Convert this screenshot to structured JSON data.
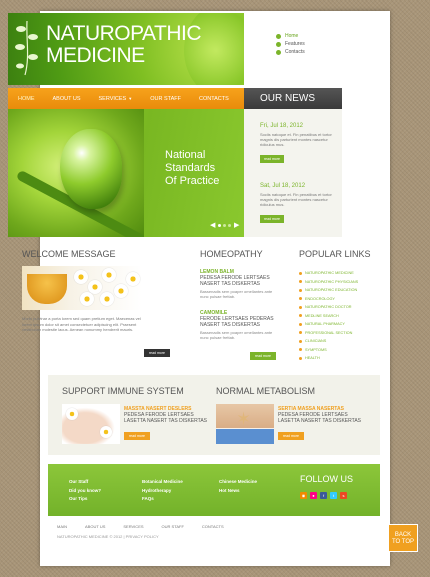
{
  "header": {
    "logo_line1": "NATUROPATHIC",
    "logo_line2": "MEDICINE",
    "top_links": [
      "Home",
      "Features",
      "Contacts"
    ]
  },
  "nav": {
    "items": [
      "HOME",
      "ABOUT US",
      "SERVICES",
      "OUR STAFF",
      "CONTACTS"
    ],
    "active": "HOME"
  },
  "news": {
    "title": "OUR NEWS",
    "items": [
      {
        "date": "Fri, Jul 18, 2012",
        "text": "Sociis natoque et. Fin penatibus et tortor magnis dis parturient montes nascetur ridiculus mus.",
        "button": "read more"
      },
      {
        "date": "Sat, Jul 18, 2012",
        "text": "Sociis natoque et. Fin penatibus et tortor magnis dis parturient montes nascetur ridiculus mus.",
        "button": "read more"
      }
    ]
  },
  "slider": {
    "line1": "National",
    "line2": "Standards",
    "line3": "Of Practice",
    "prev": "◀",
    "next": "▶"
  },
  "welcome": {
    "title": "WELCOME MESSAGE",
    "text": "Morbi pulvinar a porta lorem sed quam pretium eget. Maecenas vel lorem ipsum dolor sit amet consectetuer adipiscing elit. Praesent vestibulum molestie lacus. Aenean nonummy hendrerit mauris.",
    "button": "read more"
  },
  "homeopathy": {
    "title": "HOMEOPATHY",
    "items": [
      {
        "head": "LEMON BALM",
        "sub": "PEDESA FERODE LERTSAES NASERT TAS DISKERTAS",
        "text": "Bassenadis sem poaper omellantes ante nunc pulsae frettab."
      },
      {
        "head": "CAMOMILE",
        "sub": "FERODE LERTSAES PEDERAS NASERT TAS DISKERTAS",
        "text": "Bassenadis sem poaper omellantes ante nunc pulsae frettab."
      }
    ],
    "button": "read more"
  },
  "popular": {
    "title": "POPULAR LINKS",
    "links": [
      "Naturopathic medicine",
      "Naturopathic physicians",
      "Naturopathic education",
      "Endocrology",
      "Naturopathic doctor",
      "Medline search",
      "Natural pharmacy",
      "Professional section",
      "Clinicians",
      "Symptoms",
      "Health"
    ]
  },
  "immune": {
    "title": "SUPPORT IMMUNE SYSTEM",
    "head": "MASSTA NASERT DESLERS",
    "sub": "PEDESA FERODE LERTSAES LASETTA NASERT TAS DISKERTAS",
    "button": "read more"
  },
  "metabolism": {
    "title": "NORMAL METABOLISM",
    "head": "SERTIA MASSA NASERTAS",
    "sub": "PEDESA FERODE LERTSAES LASETTA NASERT TAS DISKERTAS",
    "button": "read more"
  },
  "footer": {
    "col1": [
      "Our Staff",
      "Did you know?",
      "Our Tips"
    ],
    "col2": [
      "Botanical Medicine",
      "Hydrotherapy",
      "FAQs"
    ],
    "col3": [
      "Chinese Medicine",
      "Hot News"
    ],
    "follow_title": "FOLLOW US",
    "social": [
      "rss-icon",
      "flickr-icon",
      "facebook-icon",
      "twitter-icon",
      "stumbleupon-icon"
    ],
    "bottom_nav": [
      "MAIN",
      "ABOUT US",
      "SERVICES",
      "OUR STAFF",
      "CONTACTS"
    ],
    "copyright": "NATUROPATHIC MEDICINE © 2012 | PRIVACY POLICY",
    "back_top_1": "BACK",
    "back_top_2": "TO TOP"
  },
  "colors": {
    "green": "#7bb42a",
    "orange": "#f0a020",
    "dark": "#3a3a3a",
    "background": "#a89578"
  }
}
